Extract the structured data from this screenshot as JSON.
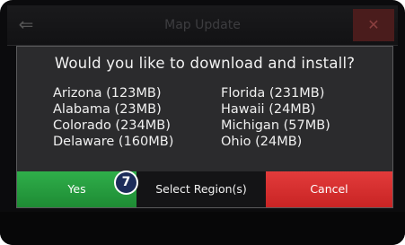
{
  "topbar": {
    "title": "Map Update",
    "back_icon": "back-arrow-icon",
    "close_icon": "close-icon",
    "close_glyph": "✕",
    "back_glyph": "⇐"
  },
  "dialog": {
    "question": "Would you like to download and install?",
    "regions": [
      "Arizona (123MB)",
      "Florida (231MB)",
      "Alabama (23MB)",
      "Hawaii (24MB)",
      "Colorado (234MB)",
      "Michigan (57MB)",
      "Delaware (160MB)",
      "Ohio (24MB)"
    ],
    "buttons": {
      "yes": "Yes",
      "select_region": "Select Region(s)",
      "cancel": "Cancel"
    }
  },
  "callout": {
    "step_number": "7"
  },
  "colors": {
    "yes_green": "#1e8b34",
    "cancel_red": "#c82424",
    "badge_navy": "#1d2c5a",
    "dialog_bg": "#2b2b2d"
  }
}
